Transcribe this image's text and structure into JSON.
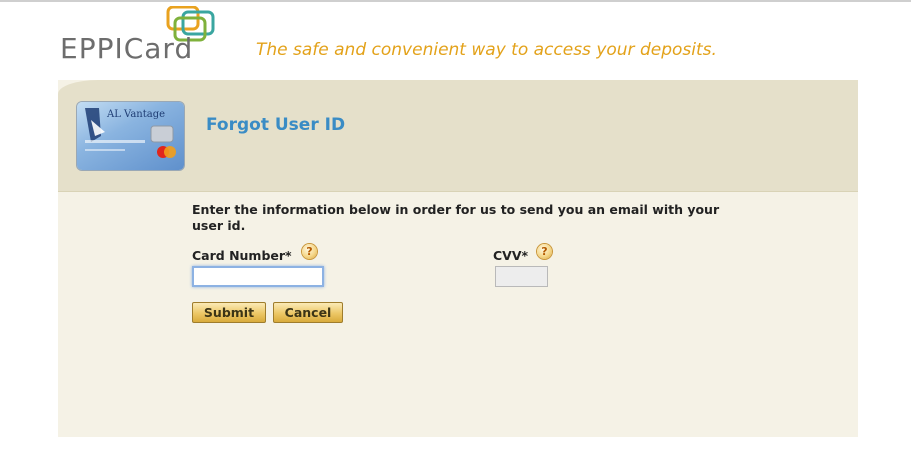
{
  "brand": {
    "logo_text": "EPPICard",
    "tagline": "The safe and convenient way to access your deposits."
  },
  "card": {
    "brand_text": "AL Vantage"
  },
  "page": {
    "title": "Forgot User ID"
  },
  "form": {
    "instructions": "Enter the information below in order for us to send you an email with your user id.",
    "card_number": {
      "label": "Card Number*",
      "value": "",
      "help": "?"
    },
    "cvv": {
      "label": "CVV*",
      "value": "",
      "help": "?"
    },
    "submit_label": "Submit",
    "cancel_label": "Cancel"
  },
  "colors": {
    "tagline": "#e3a21a",
    "title": "#3a8cc5",
    "header_band": "#e5e0ca",
    "panel": "#f5f2e6",
    "button": "#ecc766"
  }
}
